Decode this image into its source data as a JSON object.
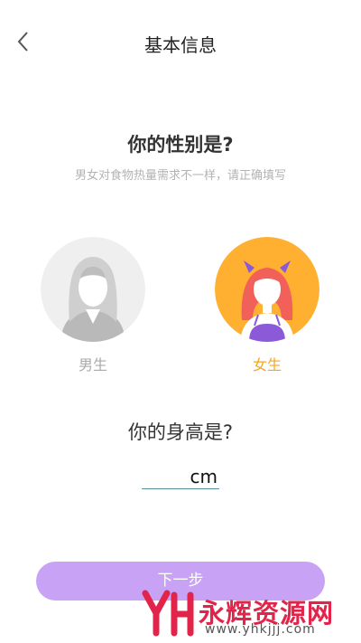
{
  "header": {
    "title": "基本信息",
    "back_icon": "chevron-left-icon"
  },
  "gender_section": {
    "question": "你的性别是?",
    "subtitle": "男女对食物热量需求不一样，请正确填写",
    "options": [
      {
        "label": "男生",
        "selected": false
      },
      {
        "label": "女生",
        "selected": true
      }
    ]
  },
  "height_section": {
    "question": "你的身高是?",
    "value": "",
    "unit": "cm"
  },
  "next_button": {
    "label": "下一步"
  },
  "watermark": {
    "name": "永辉资源网",
    "url": "www.yhkjjj.com"
  },
  "colors": {
    "accent": "#c8a2f4",
    "female_selected": "#f5a623",
    "male_unselected": "#aaaaaa",
    "female_avatar_bg": "#ffb031",
    "watermark_red": "#e2234a"
  }
}
